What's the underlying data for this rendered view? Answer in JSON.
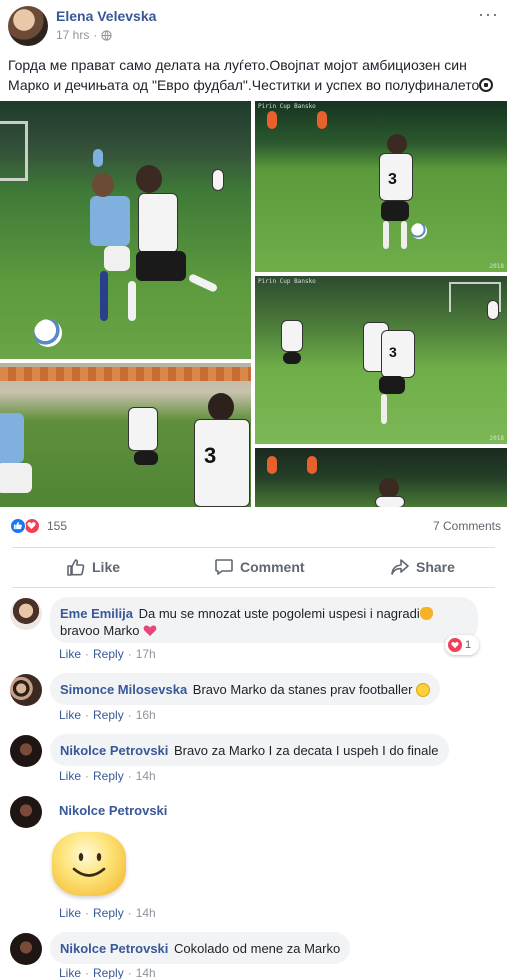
{
  "post": {
    "author": "Elena Velevska",
    "time": "17 hrs",
    "separator": "·",
    "privacy_icon": "globe-icon",
    "more_icon": "more-dots-icon",
    "text": "Горда ме прават само делата на луѓето.Овојпат мојот амбициозен син Марко и дечињата од \"Евро фудбал\".Честитки и успех во полуфиналето",
    "photo_watermark": "Pirin Cup Bansko",
    "photo_year": "2018"
  },
  "reactions": {
    "count": "155",
    "comments": "7 Comments",
    "colors": {
      "like": "#1877f2",
      "love": "#f33e58"
    }
  },
  "actions": {
    "like": "Like",
    "comment": "Comment",
    "share": "Share"
  },
  "comments": [
    {
      "name": "Eme Emilija",
      "text": "Da mu se mnozat uste pogolemi uspesi i nagradi",
      "text2": "bravoo Marko",
      "like": "Like",
      "reply": "Reply",
      "time": "17h",
      "reaction_count": "1"
    },
    {
      "name": "Simonce Milosevska",
      "text": "Bravo Marko da stanes prav footballer",
      "like": "Like",
      "reply": "Reply",
      "time": "16h"
    },
    {
      "name": "Nikolce Petrovski",
      "text": "Bravo za Marko I za decata I uspeh I do finale",
      "like": "Like",
      "reply": "Reply",
      "time": "14h"
    },
    {
      "name": "Nikolce Petrovski",
      "text": "",
      "sticker": "smiley-sticker",
      "like": "Like",
      "reply": "Reply",
      "time": "14h"
    },
    {
      "name": "Nikolce Petrovski",
      "text": "Cokolado od mene za Marko",
      "like": "Like",
      "reply": "Reply",
      "time": "14h"
    }
  ]
}
